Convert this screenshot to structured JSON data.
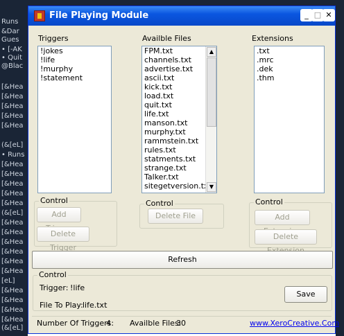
{
  "background": {
    "lines": [
      "Runs",
      "&Dar",
      "Gues",
      "• [-AK",
      "• Quit",
      "[&Hea",
      "[&Hea",
      "[&Hea",
      "[&Hea",
      "[&Hea",
      "(&[eL]",
      "• Runs",
      "[&Hea",
      "[&Hea",
      "[&Hea",
      "[&Hea",
      "[&Hea",
      "(&[eL]",
      "[&Hea",
      "[&Hea",
      "[&Hea",
      "[&Hea",
      "[&Hea",
      "[&Hea",
      "[eL]",
      "[&Hea",
      "[&Hea",
      "[&Hea",
      "[&Hea",
      "(&[eL]",
      "@Blac"
    ]
  },
  "window": {
    "title": "File Playing Module",
    "min_glyph": "_",
    "max_glyph": "□",
    "close_glyph": "✕"
  },
  "triggers": {
    "label": "Triggers",
    "items": [
      "!jokes",
      "!life",
      "!murphy",
      "!statement"
    ],
    "control_label": "Control",
    "add_label": "Add Trigger",
    "delete_label": "Delete Trigger"
  },
  "files": {
    "label": "Availble Files",
    "items": [
      "FPM.txt",
      "channels.txt",
      "advertise.txt",
      "ascii.txt",
      "kick.txt",
      "load.txt",
      "quit.txt",
      "life.txt",
      "manson.txt",
      "murphy.txt",
      "rammstein.txt",
      "rules.txt",
      "statments.txt",
      "strange.txt",
      "Talker.txt",
      "sitegetversion.txt"
    ],
    "control_label": "Control",
    "delete_label": "Delete File",
    "scroll_up": "▲",
    "scroll_down": "▼"
  },
  "extensions": {
    "label": "Extensions",
    "items": [
      ".txt",
      ".mrc",
      ".dek",
      ".thm"
    ],
    "control_label": "Control",
    "add_label": "Add Extension",
    "delete_label": "Delete Extension"
  },
  "refresh_label": "Refresh",
  "control": {
    "label": "Control",
    "trigger_label": "Trigger:",
    "trigger_value": "!life",
    "file_label": "File To Play:",
    "file_value": "life.txt",
    "save_label": "Save"
  },
  "status": {
    "triggers_label": "Number Of Triggers:",
    "triggers_count": "4",
    "files_label": "Availble Files:",
    "files_count": "30",
    "link": "www.XeroCreative.Com"
  }
}
